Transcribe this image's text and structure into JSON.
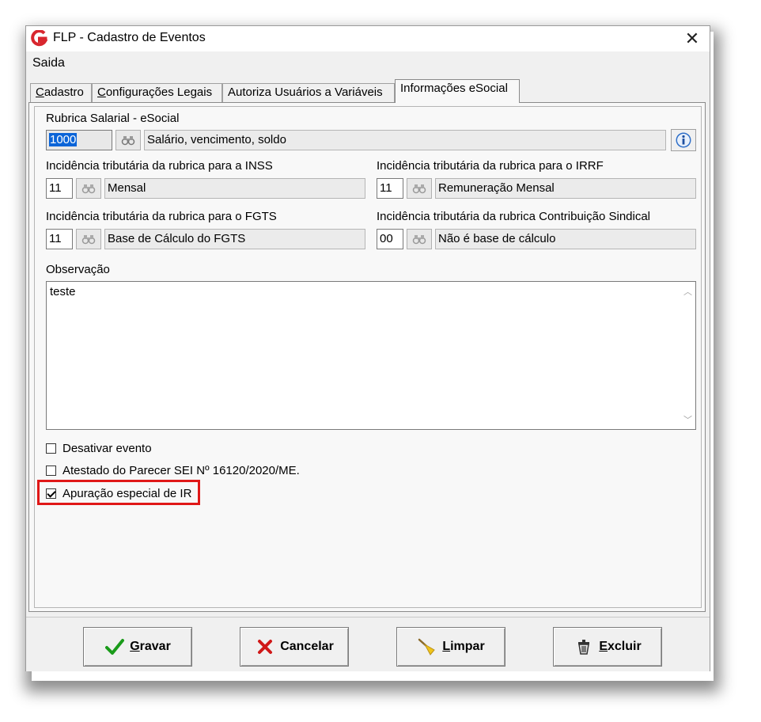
{
  "window": {
    "title": "FLP - Cadastro de Eventos",
    "close_glyph": "✕",
    "icon": "flp-logo-icon"
  },
  "menu": {
    "items": [
      "Saida"
    ]
  },
  "tabs": [
    {
      "first": "C",
      "rest": "adastro",
      "active": false
    },
    {
      "first": "C",
      "rest": "onfigurações Legais",
      "active": false
    },
    {
      "first": "",
      "rest": "Autoriza Usuários a Variáveis",
      "active": false
    },
    {
      "first": "",
      "rest": "Informações eSocial",
      "active": true
    }
  ],
  "rubrica": {
    "label": "Rubrica Salarial - eSocial",
    "code": "1000",
    "description": "Salário, vencimento, soldo"
  },
  "inss": {
    "label": "Incidência tributária da rubrica para a INSS",
    "code": "11",
    "description": "Mensal"
  },
  "irrf": {
    "label": "Incidência tributária da rubrica para o IRRF",
    "code": "11",
    "description": "Remuneração Mensal"
  },
  "fgts": {
    "label": "Incidência tributária da rubrica para o FGTS",
    "code": "11",
    "description": "Base de Cálculo do FGTS"
  },
  "sindical": {
    "label": "Incidência tributária da rubrica Contribuição Sindical",
    "code": "00",
    "description": "Não é base de cálculo"
  },
  "observacao": {
    "label": "Observação",
    "value": "teste"
  },
  "checkboxes": [
    {
      "label": "Desativar evento",
      "checked": false
    },
    {
      "label": "Atestado do Parecer SEI Nº 16120/2020/ME.",
      "checked": false
    },
    {
      "label": "Apuração especial de IR",
      "checked": true
    }
  ],
  "highlight_color": "#e01818",
  "buttons": {
    "gravar": {
      "first": "G",
      "rest": "ravar",
      "icon": "check-icon",
      "color": "#1a9b1a"
    },
    "cancelar": {
      "first": "",
      "rest": "Cancelar",
      "icon": "x-icon",
      "color": "#d01818"
    },
    "limpar": {
      "first": "L",
      "rest": "impar",
      "icon": "broom-icon"
    },
    "excluir": {
      "first": "E",
      "rest": "xcluir",
      "icon": "trash-icon"
    }
  }
}
